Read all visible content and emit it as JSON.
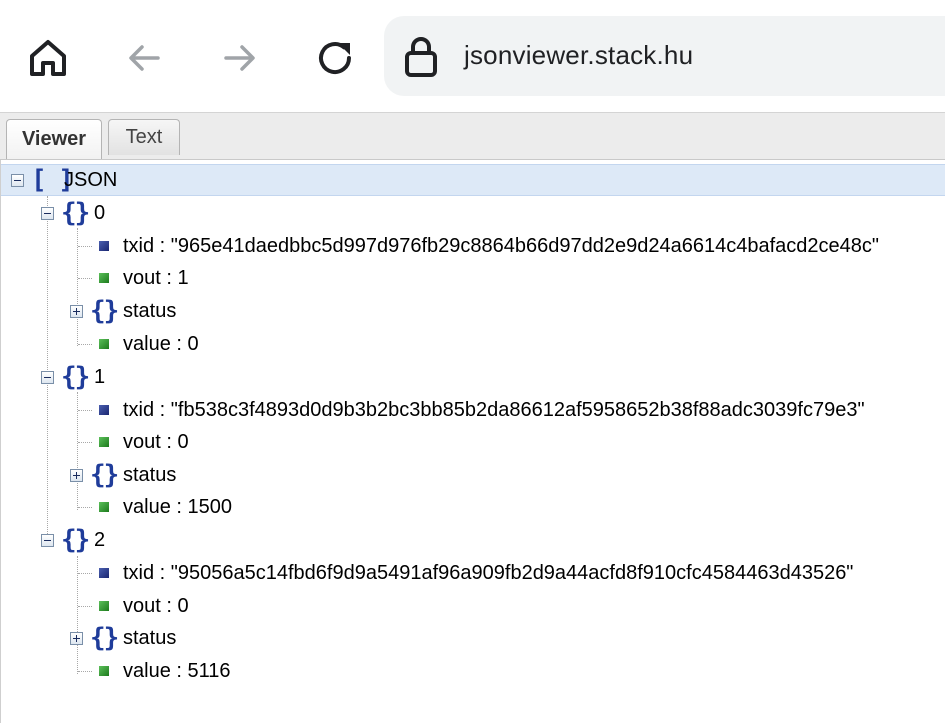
{
  "browser": {
    "url": "jsonviewer.stack.hu",
    "icons": [
      "home-icon",
      "back-arrow-icon",
      "forward-arrow-icon",
      "reload-icon",
      "lock-icon"
    ]
  },
  "tabs": [
    {
      "label": "Viewer",
      "active": true
    },
    {
      "label": "Text",
      "active": false
    }
  ],
  "tree": {
    "root_label": "JSON",
    "items": [
      {
        "index_label": "0",
        "txid": "txid : \"965e41daedbbc5d997d976fb29c8864b66d97dd2e9d24a6614c4bafacd2ce48c\"",
        "vout": "vout : 1",
        "status": "status",
        "value": "value : 0"
      },
      {
        "index_label": "1",
        "txid": "txid : \"fb538c3f4893d0d9b3b2bc3bb85b2da86612af5958652b38f88adc3039fc79e3\"",
        "vout": "vout : 0",
        "status": "status",
        "value": "value : 1500"
      },
      {
        "index_label": "2",
        "txid": "txid : \"95056a5c14fbd6f9d9a5491af96a909fb2d9a44acfd8f910cfc4584463d43526\"",
        "vout": "vout : 0",
        "status": "status",
        "value": "value : 5116"
      }
    ]
  },
  "colors": {
    "selected_row": "#dde9f7",
    "brace": "#1f3c9a",
    "string_marker": "#2a3a8c",
    "number_marker": "#2e9a2e"
  }
}
